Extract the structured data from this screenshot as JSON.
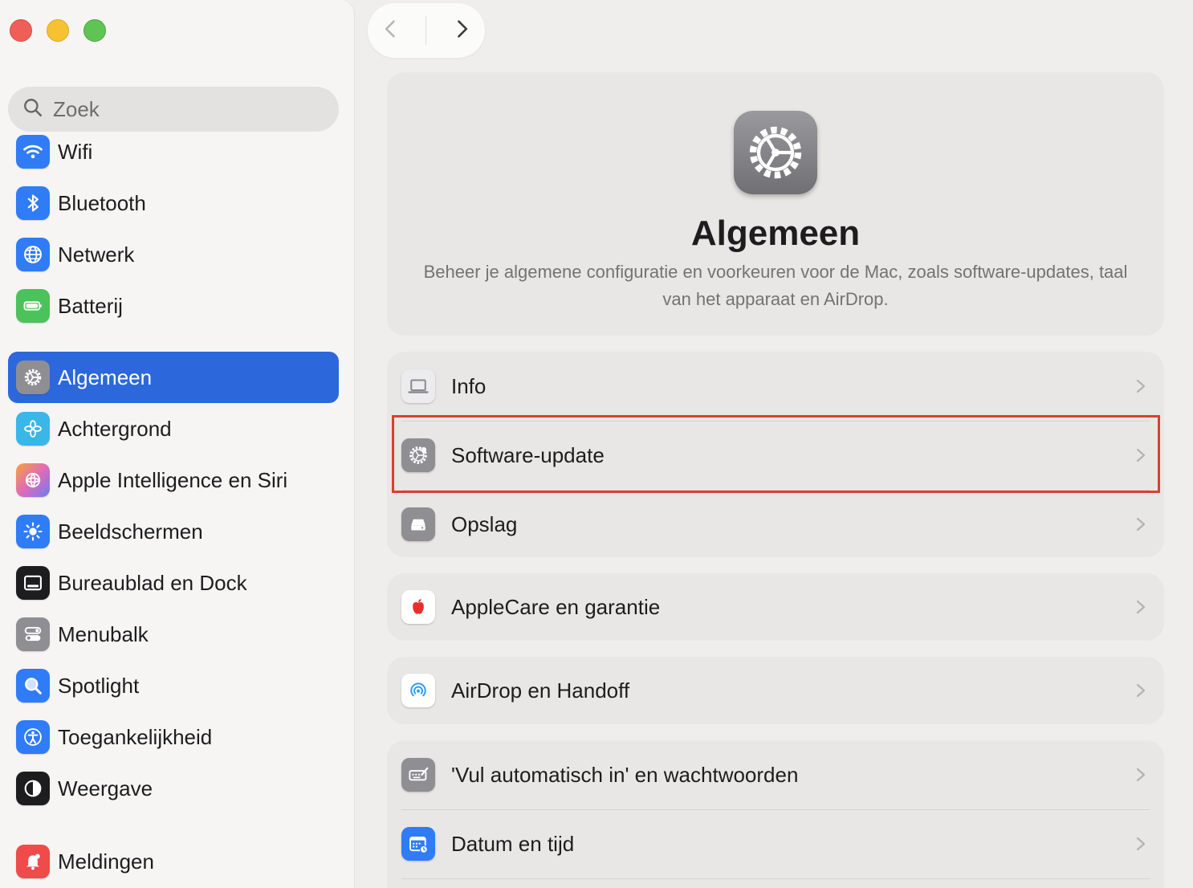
{
  "window": {
    "controls": [
      "close",
      "minimize",
      "zoom"
    ]
  },
  "search": {
    "placeholder": "Zoek"
  },
  "sidebar": {
    "group1": [
      {
        "label": "Wifi",
        "icon": "wifi-icon",
        "color": "#2f7cf6"
      },
      {
        "label": "Bluetooth",
        "icon": "bluetooth-icon",
        "color": "#2f7cf6"
      },
      {
        "label": "Netwerk",
        "icon": "globe-icon",
        "color": "#2f7cf6"
      },
      {
        "label": "Batterij",
        "icon": "battery-icon",
        "color": "#4cc25a"
      }
    ],
    "group2": [
      {
        "label": "Algemeen",
        "icon": "gear-icon",
        "color": "#8e8e93",
        "active": true
      },
      {
        "label": "Achtergrond",
        "icon": "flower-icon",
        "color": "#3ab7e8"
      },
      {
        "label": "Apple Intelligence en Siri",
        "icon": "siri-icon",
        "color": "#e06bb8"
      },
      {
        "label": "Beeldschermen",
        "icon": "sun-icon",
        "color": "#2f7cf6"
      },
      {
        "label": "Bureaublad en Dock",
        "icon": "dock-icon",
        "color": "#1d1d1f"
      },
      {
        "label": "Menubalk",
        "icon": "menubar-icon",
        "color": "#8e8e93"
      },
      {
        "label": "Spotlight",
        "icon": "magnifier-icon",
        "color": "#2f7cf6"
      },
      {
        "label": "Toegankelijkheid",
        "icon": "accessibility-icon",
        "color": "#2f7cf6"
      },
      {
        "label": "Weergave",
        "icon": "appearance-icon",
        "color": "#1d1d1f"
      }
    ],
    "group3": [
      {
        "label": "Meldingen",
        "icon": "bell-icon",
        "color": "#ee4b4b"
      }
    ]
  },
  "header": {
    "title": "Algemeen",
    "description": "Beheer je algemene configuratie en voorkeuren voor de Mac, zoals software-updates, taal van het apparaat en AirDrop."
  },
  "rows": {
    "info": "Info",
    "software_update": "Software-update",
    "storage": "Opslag",
    "applecare": "AppleCare en garantie",
    "airdrop": "AirDrop en Handoff",
    "autofill": "'Vul automatisch in' en wachtwoorden",
    "datetime": "Datum en tijd"
  },
  "colors": {
    "accent": "#2c68dc",
    "highlight": "#d8412e"
  }
}
